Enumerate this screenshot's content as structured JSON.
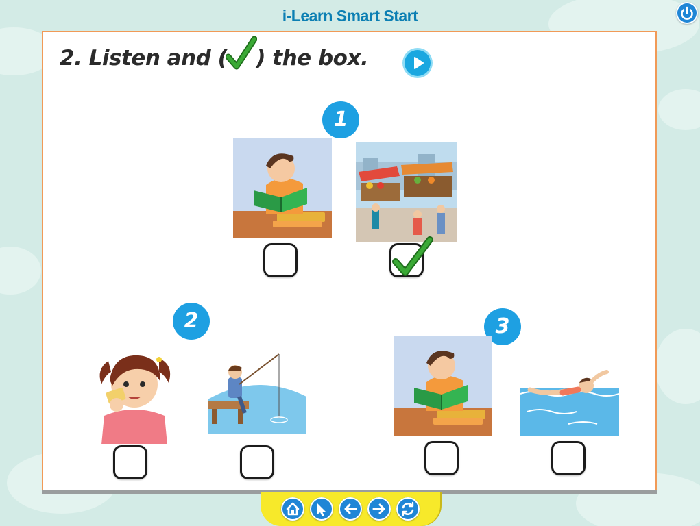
{
  "app": {
    "title": "i-Learn Smart Start"
  },
  "exercise": {
    "instruction_before": "2. Listen and (",
    "instruction_after": ") the box.",
    "questions": [
      {
        "number": "1",
        "options": [
          {
            "picture": "boy-reading-book",
            "checked": false
          },
          {
            "picture": "market-street-scene",
            "checked": true
          }
        ]
      },
      {
        "number": "2",
        "options": [
          {
            "picture": "girl-eating-sandwich",
            "checked": false
          },
          {
            "picture": "boy-fishing-on-pier",
            "checked": false
          }
        ]
      },
      {
        "number": "3",
        "options": [
          {
            "picture": "boy-reading-book",
            "checked": false
          },
          {
            "picture": "person-swimming",
            "checked": false
          }
        ]
      }
    ]
  },
  "icons": {
    "power": "power-icon",
    "play": "play-icon",
    "check": "checkmark-icon",
    "nav": [
      "home-icon",
      "pointer-icon",
      "arrow-left-icon",
      "arrow-right-icon",
      "refresh-icon"
    ]
  },
  "colors": {
    "brand_title": "#0c7fb3",
    "accent_blue": "#1ea0e2",
    "panel_border": "#f19a57",
    "check_green": "#3aa935",
    "nav_bar": "#f7e92a"
  }
}
